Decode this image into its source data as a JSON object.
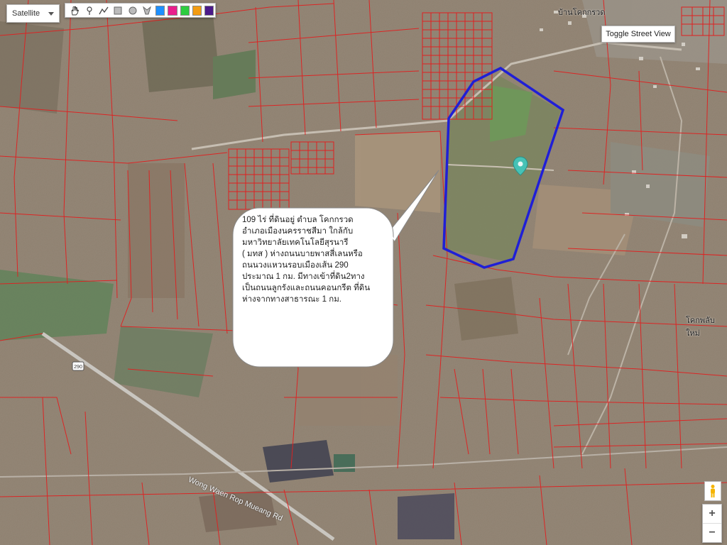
{
  "map": {
    "map_type_label": "Satellite",
    "toggle_street_view_label": "Toggle Street View",
    "zoom_in_label": "+",
    "zoom_out_label": "−",
    "drawing_tools": [
      "hand-icon",
      "marker-icon",
      "polyline-icon",
      "rectangle-icon",
      "circle-icon",
      "polygon-icon"
    ],
    "color_swatches": [
      "#1e90ff",
      "#e91e8c",
      "#2ecc40",
      "#f39c12",
      "#4b1a8a"
    ],
    "outline_color": "#1f1fd6",
    "parcel_line_color": "#e02020",
    "place_labels": [
      "บ้านโคกกรวด",
      "โคกพลับใหม่"
    ],
    "road_label": "Wong Waen Rop Mueang Rd",
    "route_shield": "290"
  },
  "annotation": {
    "lines": [
      "109 ไร่  ที่ดินอยู่ ตำบล โคกกรวด",
      "อำเภอเมืองนครราชสีมา ใกล้กับ",
      "มหาวิทยาลัยเทคโนโลยีสุรนารี",
      " ( มทส ) ห่างถนนบายพาสสี่เลนหรือ",
      "ถนนวงแหวนรอบเมืองเส้น 290",
      "ประมาณ 1 กม. มีทางเข้าที่ดิน2ทาง",
      "เป็นถนนลูกรังและถนนคอนกรีต ที่ดิน",
      "ห่างจากทางสาธารณะ 1 กม."
    ]
  }
}
